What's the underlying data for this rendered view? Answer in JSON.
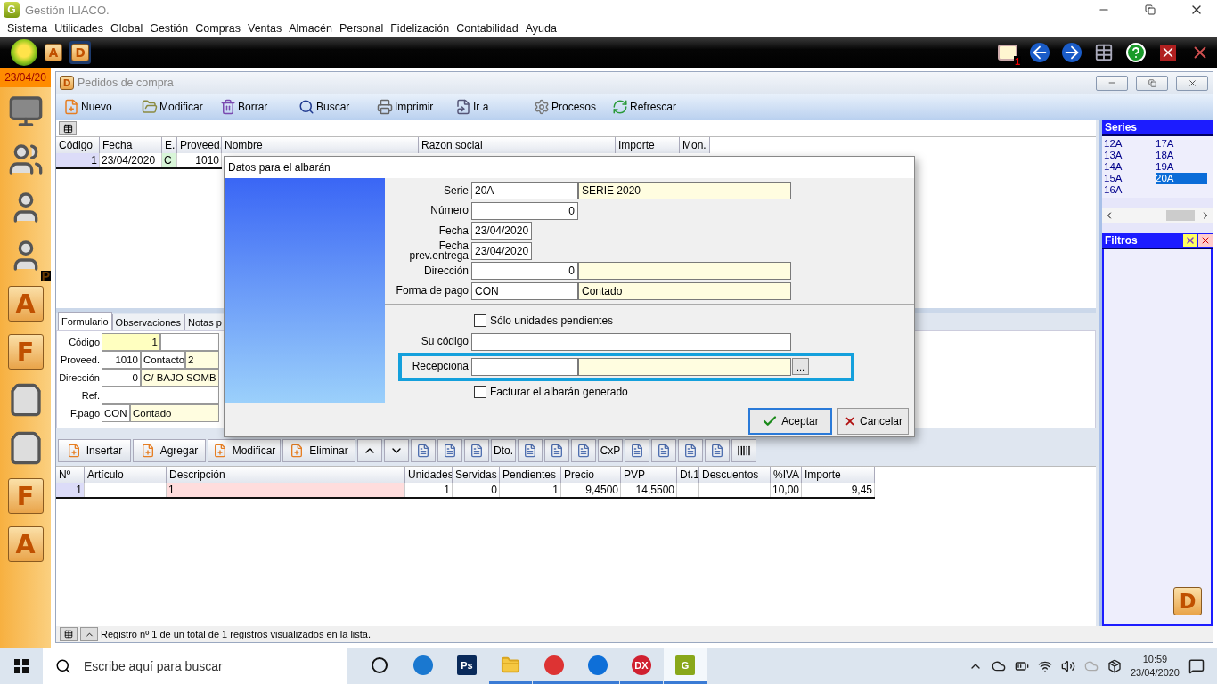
{
  "window": {
    "icon_letter": "G",
    "title": "Gestión ILIACO."
  },
  "menu": [
    "Sistema",
    "Utilidades",
    "Global",
    "Gestión",
    "Compras",
    "Ventas",
    "Almacén",
    "Personal",
    "Fidelización",
    "Contabilidad",
    "Ayuda"
  ],
  "quickbar": {
    "items": [
      {
        "label": "A",
        "selected": false
      },
      {
        "label": "D",
        "selected": true
      }
    ],
    "mail_count": "1"
  },
  "sidebar": {
    "date": "23/04/20",
    "items": [
      {
        "kind": "monitor"
      },
      {
        "kind": "people"
      },
      {
        "kind": "person"
      },
      {
        "kind": "person",
        "badge": "P"
      },
      {
        "kind": "letter",
        "label": "A"
      },
      {
        "kind": "letter",
        "label": "F"
      },
      {
        "kind": "bag"
      },
      {
        "kind": "bag"
      },
      {
        "kind": "letter",
        "label": "F"
      },
      {
        "kind": "letter",
        "label": "A"
      }
    ]
  },
  "doc_window": {
    "icon_letter": "D",
    "title": "Pedidos de compra",
    "toolbar": [
      {
        "kind": "new",
        "label": "Nuevo"
      },
      {
        "kind": "edit",
        "label": "Modificar"
      },
      {
        "kind": "delete",
        "label": "Borrar"
      },
      {
        "kind": "search",
        "label": "Buscar"
      },
      {
        "kind": "print",
        "label": "Imprimir"
      },
      {
        "kind": "goto",
        "label": "Ir a"
      },
      {
        "kind": "process",
        "label": "Procesos"
      },
      {
        "kind": "refresh",
        "label": "Refrescar"
      }
    ],
    "orders": {
      "columns": [
        "Código",
        "Fecha",
        "E.",
        "Proveed.",
        "Nombre",
        "Razon social",
        "Importe",
        "Mon."
      ],
      "rows": [
        {
          "selected": true,
          "cells": [
            "1",
            "23/04/2020",
            "C",
            "1010"
          ]
        }
      ]
    },
    "tabs": [
      {
        "label": "Formulario",
        "selected": true
      },
      {
        "label": "Observaciones",
        "selected": false
      },
      {
        "label": "Notas p",
        "selected": false
      }
    ],
    "form": [
      {
        "label": "Código",
        "cells": [
          {
            "kind": "key",
            "text": "1"
          },
          {
            "kind": "blank"
          }
        ]
      },
      {
        "label": "Proveed.",
        "cells": [
          {
            "kind": "num",
            "text": "1010"
          },
          {
            "kind": "caption",
            "text": "Contacto"
          },
          {
            "kind": "desc",
            "text": "2"
          }
        ]
      },
      {
        "label": "Dirección",
        "cells": [
          {
            "kind": "num",
            "text": "0"
          },
          {
            "kind": "desc",
            "text": "C/ BAJO SOMB"
          }
        ]
      },
      {
        "label": "Ref.",
        "cells": [
          {
            "kind": "blank"
          }
        ]
      },
      {
        "label": "F.pago",
        "cells": [
          {
            "kind": "code",
            "text": "CON"
          },
          {
            "kind": "desc",
            "text": "Contado"
          }
        ]
      }
    ],
    "line_toolbar": [
      {
        "kind": "labeled",
        "label": "Insertar"
      },
      {
        "kind": "labeled",
        "label": "Agregar"
      },
      {
        "kind": "labeled",
        "label": "Modificar"
      },
      {
        "kind": "labeled",
        "label": "Eliminar"
      },
      {
        "kind": "up"
      },
      {
        "kind": "down"
      },
      {
        "kind": "icon"
      },
      {
        "kind": "icon"
      },
      {
        "kind": "icon"
      },
      {
        "kind": "text",
        "label": "Dto."
      },
      {
        "kind": "icon"
      },
      {
        "kind": "icon"
      },
      {
        "kind": "icon"
      },
      {
        "kind": "text",
        "label": "CxP"
      },
      {
        "kind": "icon"
      },
      {
        "kind": "icon"
      },
      {
        "kind": "icon"
      },
      {
        "kind": "icon"
      },
      {
        "kind": "barcode"
      }
    ],
    "lines": {
      "columns": [
        "Nº",
        "Artículo",
        "Descripción",
        "Unidades",
        "Servidas",
        "Pendientes",
        "Precio",
        "PVP",
        "Dt.1",
        "Descuentos",
        "%IVA",
        "Importe"
      ],
      "rows": [
        {
          "selected": true,
          "cells": [
            "1",
            "",
            "1",
            "1",
            "0",
            "1",
            "9,4500",
            "14,5500",
            "",
            "",
            "10,00",
            "9,45"
          ]
        }
      ]
    },
    "series": {
      "title": "Series",
      "items": [
        {
          "label": "12A",
          "selected": false
        },
        {
          "label": "13A",
          "selected": false
        },
        {
          "label": "14A",
          "selected": false
        },
        {
          "label": "15A",
          "selected": false
        },
        {
          "label": "16A",
          "selected": false
        },
        {
          "label": "17A",
          "selected": false
        },
        {
          "label": "18A",
          "selected": false
        },
        {
          "label": "19A",
          "selected": false
        },
        {
          "label": "20A",
          "selected": true
        }
      ]
    },
    "filters": {
      "title": "Filtros"
    },
    "corner_letter": "D",
    "status": "Registro nº 1 de un total de 1 registros visualizados en la lista."
  },
  "dialog": {
    "title": "Datos para el albarán",
    "fields": [
      {
        "kind": "pair",
        "label": "Serie",
        "code": "20A",
        "desc": "SERIE 2020"
      },
      {
        "kind": "number",
        "label": "Número",
        "value": "0"
      },
      {
        "kind": "date",
        "label": "Fecha",
        "value": "23/04/2020"
      },
      {
        "kind": "date",
        "label": "Fecha prev.entrega",
        "value": "23/04/2020"
      },
      {
        "kind": "numpair",
        "label": "Dirección",
        "code": "0"
      },
      {
        "kind": "pair",
        "label": "Forma de pago",
        "code": "CON",
        "desc": "Contado"
      }
    ],
    "options": [
      {
        "kind": "check",
        "label": "Sólo unidades pendientes",
        "checked": false,
        "highlighted": false
      },
      {
        "kind": "text",
        "label": "Su código",
        "highlighted": false
      },
      {
        "kind": "lookup",
        "label": "Recepciona",
        "button": "...",
        "highlighted": true
      },
      {
        "kind": "check",
        "label": "Facturar el albarán generado",
        "checked": false,
        "highlighted": false
      }
    ],
    "buttons": [
      {
        "kind": "ok",
        "label": "Aceptar",
        "default": true
      },
      {
        "kind": "cancel",
        "label": "Cancelar",
        "default": false
      }
    ]
  },
  "taskbar": {
    "search_placeholder": "Escribe aquí para buscar",
    "apps": [
      {
        "kind": "cortana",
        "running": false,
        "selected": false
      },
      {
        "kind": "edge",
        "running": false,
        "selected": false
      },
      {
        "kind": "ps",
        "label": "Ps",
        "running": false,
        "selected": false
      },
      {
        "kind": "explorer",
        "running": true,
        "selected": false
      },
      {
        "kind": "chrome",
        "running": true,
        "selected": false
      },
      {
        "kind": "teamviewer",
        "running": true,
        "selected": false
      },
      {
        "kind": "dx",
        "label": "DX",
        "running": true,
        "selected": false
      },
      {
        "kind": "app",
        "label": "G",
        "running": true,
        "selected": true
      }
    ],
    "time": "10:59",
    "date": "23/04/2020"
  }
}
